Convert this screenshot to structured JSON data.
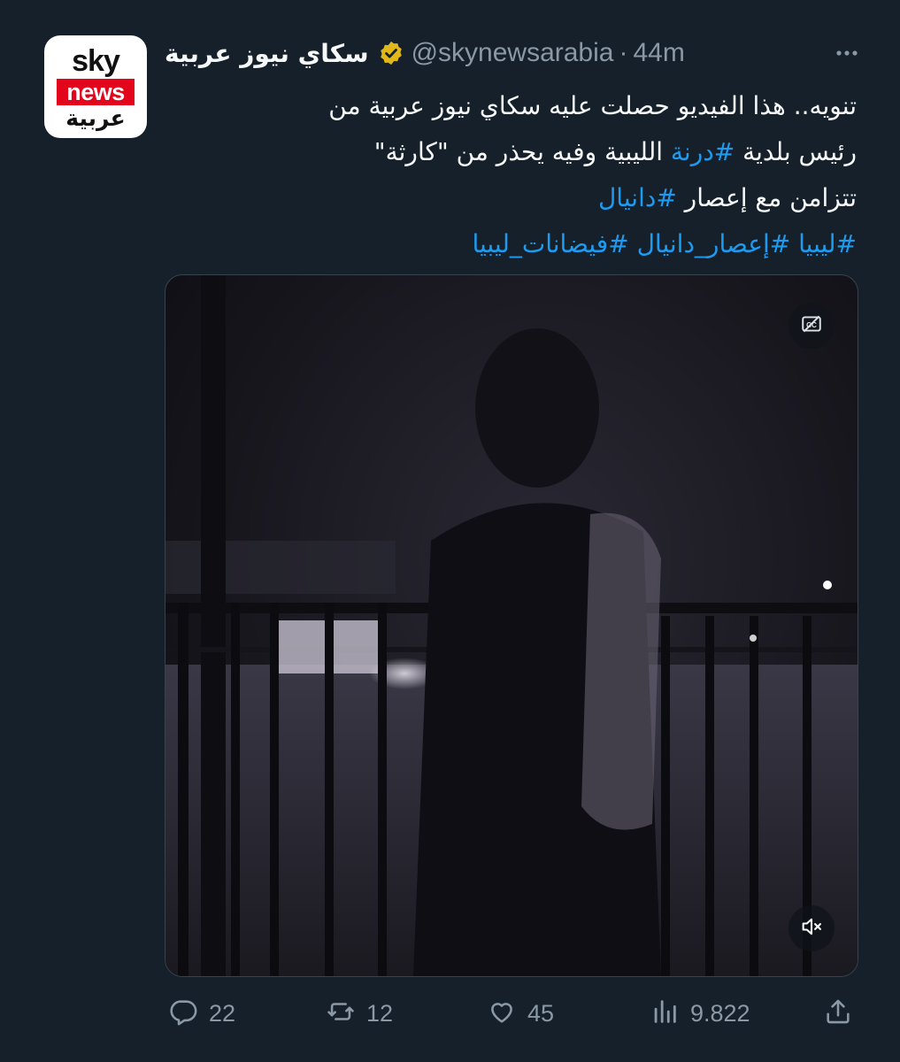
{
  "author": {
    "display_name": "سكاي نيوز عربية",
    "handle": "@skynewsarabia",
    "separator": "·",
    "time": "44m",
    "verified": true,
    "avatar": {
      "line1": "sky",
      "line2": "news",
      "line3": "عربية",
      "accent": "#e3051b"
    }
  },
  "tweet": {
    "line1": "تنويه.. هذا الفيديو حصلت عليه سكاي نيوز عربية من",
    "line2_pre": "رئيس بلدية ",
    "line2_tag": "#درنة",
    "line2_post": " الليبية وفيه يحذر من \"كارثة\"",
    "line3_pre": "تتزامن مع إعصار ",
    "line3_tag": "#دانيال",
    "line4_tag1": "#ليبيا",
    "line4_tag2": "#إعصار_دانيال",
    "line4_tag3": "#فيضانات_ليبيا"
  },
  "media": {
    "type": "video",
    "captions_icon": "closed-captions-off-icon",
    "mute_icon": "speaker-muted-icon"
  },
  "actions": {
    "replies": "22",
    "retweets": "12",
    "likes": "45",
    "views": "9.822",
    "icons": [
      "reply-icon",
      "retweet-icon",
      "like-icon",
      "views-icon",
      "share-icon"
    ]
  },
  "colors": {
    "background": "#15202b",
    "link": "#1d9bf0",
    "muted": "#8b98a5",
    "verified_badge": "#e2b719"
  }
}
